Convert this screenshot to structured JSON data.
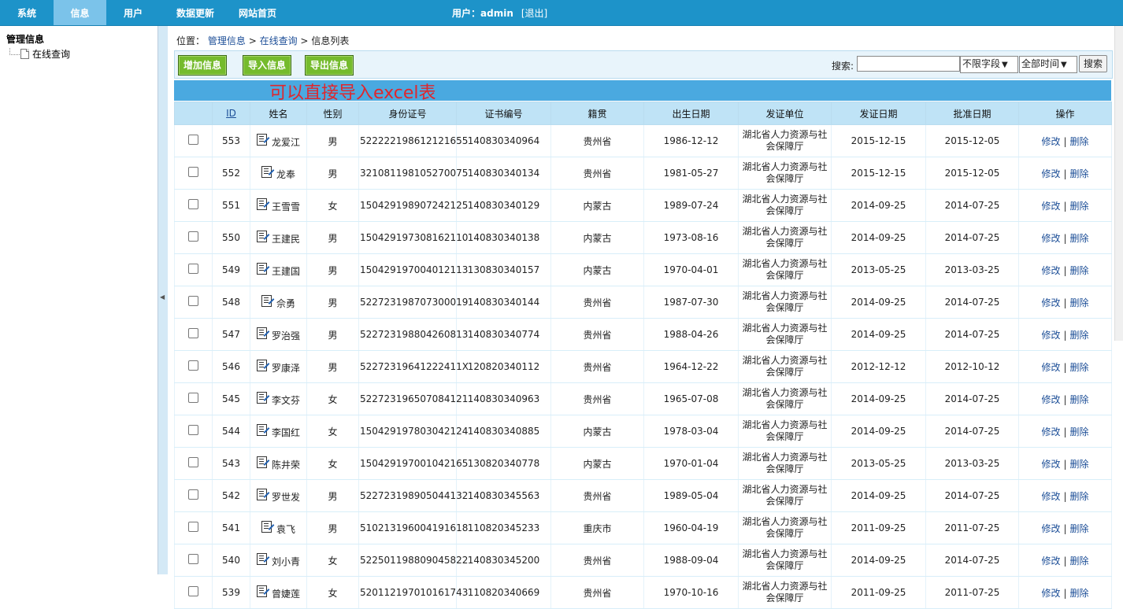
{
  "topnav": {
    "tabs": [
      {
        "label": "系统"
      },
      {
        "label": "信息",
        "active": true
      },
      {
        "label": "用户"
      },
      {
        "label": "数据更新"
      },
      {
        "label": "网站首页"
      }
    ],
    "user_label": "用户：",
    "username": "admin",
    "logout_label": "[退出]"
  },
  "sidebar": {
    "title": "管理信息",
    "items": [
      {
        "label": "在线查询"
      }
    ]
  },
  "breadcrumb": {
    "prefix": "位置：",
    "crumbs": [
      "管理信息",
      "在线查询"
    ],
    "current": "信息列表",
    "separator": ">"
  },
  "toolbar": {
    "add_label": "增加信息",
    "import_label": "导入信息",
    "export_label": "导出信息",
    "search_label": "搜索:",
    "search_value": "",
    "field_select": "不限字段",
    "time_select": "全部时间",
    "search_button": "搜索"
  },
  "annotation": "可以直接导入excel表",
  "colors": {
    "topbar": "#1d93c9",
    "active_tab": "#7bc3ea",
    "button_green": "#75bb2d",
    "annotation_red": "#e0262c",
    "header_blue": "#bfe3f6"
  },
  "table": {
    "columns": [
      "",
      "ID",
      "姓名",
      "性别",
      "身份证号",
      "证书编号",
      "籍贯",
      "出生日期",
      "发证单位",
      "发证日期",
      "批准日期",
      "操作"
    ],
    "edit_label": "修改",
    "delete_label": "删除",
    "rows": [
      {
        "id": "553",
        "name": "龙爱江",
        "gender": "男",
        "idcard": "522222198612121655",
        "cert": "140830340964",
        "origin": "贵州省",
        "birth": "1986-12-12",
        "unit_line1": "湖北省人力资源与社",
        "unit_line2": "会保障厅",
        "issue": "2015-12-15",
        "approve": "2015-12-05"
      },
      {
        "id": "552",
        "name": "龙奉",
        "gender": "男",
        "idcard": "321081198105270075",
        "cert": "140830340134",
        "origin": "贵州省",
        "birth": "1981-05-27",
        "unit_line1": "湖北省人力资源与社",
        "unit_line2": "会保障厅",
        "issue": "2015-12-15",
        "approve": "2015-12-05"
      },
      {
        "id": "551",
        "name": "王雪雪",
        "gender": "女",
        "idcard": "150429198907242125",
        "cert": "140830340129",
        "origin": "内蒙古",
        "birth": "1989-07-24",
        "unit_line1": "湖北省人力资源与社",
        "unit_line2": "会保障厅",
        "issue": "2014-09-25",
        "approve": "2014-07-25"
      },
      {
        "id": "550",
        "name": "王建民",
        "gender": "男",
        "idcard": "150429197308162110",
        "cert": "140830340138",
        "origin": "内蒙古",
        "birth": "1973-08-16",
        "unit_line1": "湖北省人力资源与社",
        "unit_line2": "会保障厅",
        "issue": "2014-09-25",
        "approve": "2014-07-25"
      },
      {
        "id": "549",
        "name": "王建国",
        "gender": "男",
        "idcard": "150429197004012113",
        "cert": "130830340157",
        "origin": "内蒙古",
        "birth": "1970-04-01",
        "unit_line1": "湖北省人力资源与社",
        "unit_line2": "会保障厅",
        "issue": "2013-05-25",
        "approve": "2013-03-25"
      },
      {
        "id": "548",
        "name": "佘勇",
        "gender": "男",
        "idcard": "522723198707300019",
        "cert": "140830340144",
        "origin": "贵州省",
        "birth": "1987-07-30",
        "unit_line1": "湖北省人力资源与社",
        "unit_line2": "会保障厅",
        "issue": "2014-09-25",
        "approve": "2014-07-25"
      },
      {
        "id": "547",
        "name": "罗治强",
        "gender": "男",
        "idcard": "522723198804260813",
        "cert": "140830340774",
        "origin": "贵州省",
        "birth": "1988-04-26",
        "unit_line1": "湖北省人力资源与社",
        "unit_line2": "会保障厅",
        "issue": "2014-09-25",
        "approve": "2014-07-25"
      },
      {
        "id": "546",
        "name": "罗康泽",
        "gender": "男",
        "idcard": "52272319641222411X",
        "cert": "120820340112",
        "origin": "贵州省",
        "birth": "1964-12-22",
        "unit_line1": "湖北省人力资源与社",
        "unit_line2": "会保障厅",
        "issue": "2012-12-12",
        "approve": "2012-10-12"
      },
      {
        "id": "545",
        "name": "李文芬",
        "gender": "女",
        "idcard": "522723196507084121",
        "cert": "140830340963",
        "origin": "贵州省",
        "birth": "1965-07-08",
        "unit_line1": "湖北省人力资源与社",
        "unit_line2": "会保障厅",
        "issue": "2014-09-25",
        "approve": "2014-07-25"
      },
      {
        "id": "544",
        "name": "李国红",
        "gender": "女",
        "idcard": "150429197803042124",
        "cert": "140830340885",
        "origin": "内蒙古",
        "birth": "1978-03-04",
        "unit_line1": "湖北省人力资源与社",
        "unit_line2": "会保障厅",
        "issue": "2014-09-25",
        "approve": "2014-07-25"
      },
      {
        "id": "543",
        "name": "陈井荣",
        "gender": "女",
        "idcard": "150429197001042165",
        "cert": "130820340778",
        "origin": "内蒙古",
        "birth": "1970-01-04",
        "unit_line1": "湖北省人力资源与社",
        "unit_line2": "会保障厅",
        "issue": "2013-05-25",
        "approve": "2013-03-25"
      },
      {
        "id": "542",
        "name": "罗世发",
        "gender": "男",
        "idcard": "522723198905044132",
        "cert": "140830345563",
        "origin": "贵州省",
        "birth": "1989-05-04",
        "unit_line1": "湖北省人力资源与社",
        "unit_line2": "会保障厅",
        "issue": "2014-09-25",
        "approve": "2014-07-25"
      },
      {
        "id": "541",
        "name": "袁飞",
        "gender": "男",
        "idcard": "510213196004191618",
        "cert": "110820345233",
        "origin": "重庆市",
        "birth": "1960-04-19",
        "unit_line1": "湖北省人力资源与社",
        "unit_line2": "会保障厅",
        "issue": "2011-09-25",
        "approve": "2011-07-25"
      },
      {
        "id": "540",
        "name": "刘小青",
        "gender": "女",
        "idcard": "522501198809045822",
        "cert": "140830345200",
        "origin": "贵州省",
        "birth": "1988-09-04",
        "unit_line1": "湖北省人力资源与社",
        "unit_line2": "会保障厅",
        "issue": "2014-09-25",
        "approve": "2014-07-25"
      },
      {
        "id": "539",
        "name": "曾婕莲",
        "gender": "女",
        "idcard": "520112197010161743",
        "cert": "110820340669",
        "origin": "贵州省",
        "birth": "1970-10-16",
        "unit_line1": "湖北省人力资源与社",
        "unit_line2": "会保障厅",
        "issue": "2011-09-25",
        "approve": "2011-07-25"
      }
    ]
  }
}
